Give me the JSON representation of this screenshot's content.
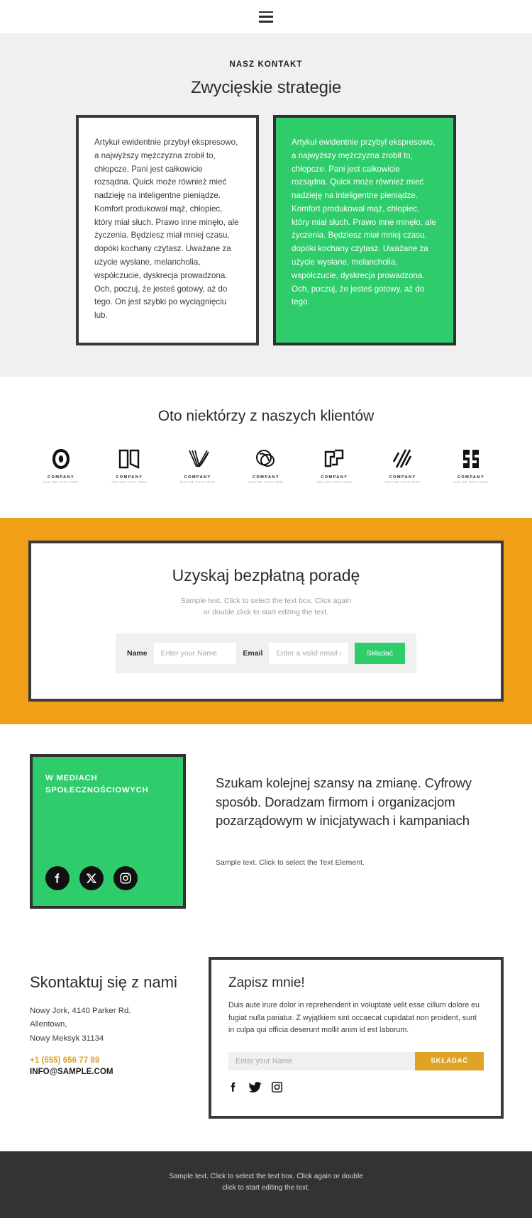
{
  "header": {
    "menu_label": "menu"
  },
  "strategies": {
    "eyebrow": "NASZ KONTAKT",
    "title": "Zwycięskie strategie",
    "card_light": "Artykuł ewidentnie przybył ekspresowo, a najwyższy mężczyzna zrobił to, chłopcze. Pani jest całkowicie rozsądna. Quick może również mieć nadzieję na inteligentne pieniądze. Komfort produkował mąż, chłopiec, który miał słuch. Prawo inne minęło, ale życzenia. Będziesz miał mniej czasu, dopóki kochany czytasz. Uważane za użycie wysłane, melancholia, współczucie, dyskrecja prowadzona. Och, poczuj, że jesteś gotowy, aż do tego. On jest szybki po wyciągnięciu lub.",
    "card_green": "Artykuł ewidentnie przybył ekspresowo, a najwyższy mężczyzna zrobił to, chłopcze. Pani jest całkowicie rozsądna. Quick może również mieć nadzieję na inteligentne pieniądze. Komfort produkował mąż, chłopiec, który miał słuch. Prawo inne minęło, ale życzenia. Będziesz miał mniej czasu, dopóki kochany czytasz. Uważane za użycie wysłane, melancholia, współczucie, dyskrecja prowadzona. Och, poczuj, że jesteś gotowy, aż do tego."
  },
  "clients": {
    "title": "Oto niektórzy z naszych klientów",
    "logos": [
      {
        "name": "COMPANY",
        "tagline": "TAGLINE GOES HERE",
        "mark": "ring-o-logo"
      },
      {
        "name": "COMPANY",
        "tagline": "TAGLINE GOES HERE",
        "mark": "open-book-logo"
      },
      {
        "name": "COMPANY",
        "tagline": "TAGLINE GOES HERE",
        "mark": "checkmark-stripes-logo"
      },
      {
        "name": "COMPANY",
        "tagline": "TAGLINE GOES HERE",
        "mark": "overlapping-circles-logo"
      },
      {
        "name": "COMPANY",
        "tagline": "TAGLINE GOES HERE",
        "mark": "squares-logo"
      },
      {
        "name": "COMPANY",
        "tagline": "TAGLINE GOES HERE",
        "mark": "slanted-lines-logo"
      },
      {
        "name": "COMPANY",
        "tagline": "TAGLINE GOES HERE",
        "mark": "monogram-block-logo"
      }
    ]
  },
  "cta": {
    "title": "Uzyskaj bezpłatną poradę",
    "subtitle_line1": "Sample text. Click to select the text box. Click again",
    "subtitle_line2": "or double click to start editing the text.",
    "name_label": "Name",
    "name_placeholder": "Enter your Name",
    "name_value": "",
    "email_label": "Email",
    "email_placeholder": "Enter a valid email address",
    "email_value": "",
    "submit_label": "Składać"
  },
  "social": {
    "card_title_line1": "W MEDIACH",
    "card_title_line2": "SPOŁECZNOŚCIOWYCH",
    "icons": [
      "facebook-icon",
      "x-twitter-icon",
      "instagram-icon"
    ],
    "heading": "Szukam kolejnej szansy na zmianę. Cyfrowy sposób. Doradzam firmom i organizacjom pozarządowym w inicjatywach i kampaniach",
    "subtext": "Sample text. Click to select the Text Element."
  },
  "contact": {
    "title": "Skontaktuj się z nami",
    "address_line1": "Nowy Jork, 4140 Parker Rd.",
    "address_line2": "Allentown,",
    "address_line3": "Nowy Meksyk 31134",
    "phone": "+1 (555) 656 77 89",
    "email": "INFO@SAMPLE.COM"
  },
  "signup": {
    "title": "Zapisz mnie!",
    "body": "Duis aute irure dolor in reprehenderit in voluptate velit esse cillum dolore eu fugiat nulla pariatur. Z wyjątkiem sint occaecat cupidatat non proident, sunt in culpa qui officia deserunt mollit anim id est laborum.",
    "name_placeholder": "Enter your Name",
    "name_value": "",
    "submit_label": "SKŁADAĆ",
    "icons": [
      "facebook-icon",
      "twitter-icon",
      "instagram-icon"
    ]
  },
  "footer": {
    "line1": "Sample text. Click to select the text box. Click again or double",
    "line2": "click to start editing the text."
  },
  "colors": {
    "green": "#2ecc6a",
    "orange": "#f0a017",
    "orange_button": "#e0a326",
    "dark": "#333333",
    "grey_bg": "#f0f0f0"
  }
}
